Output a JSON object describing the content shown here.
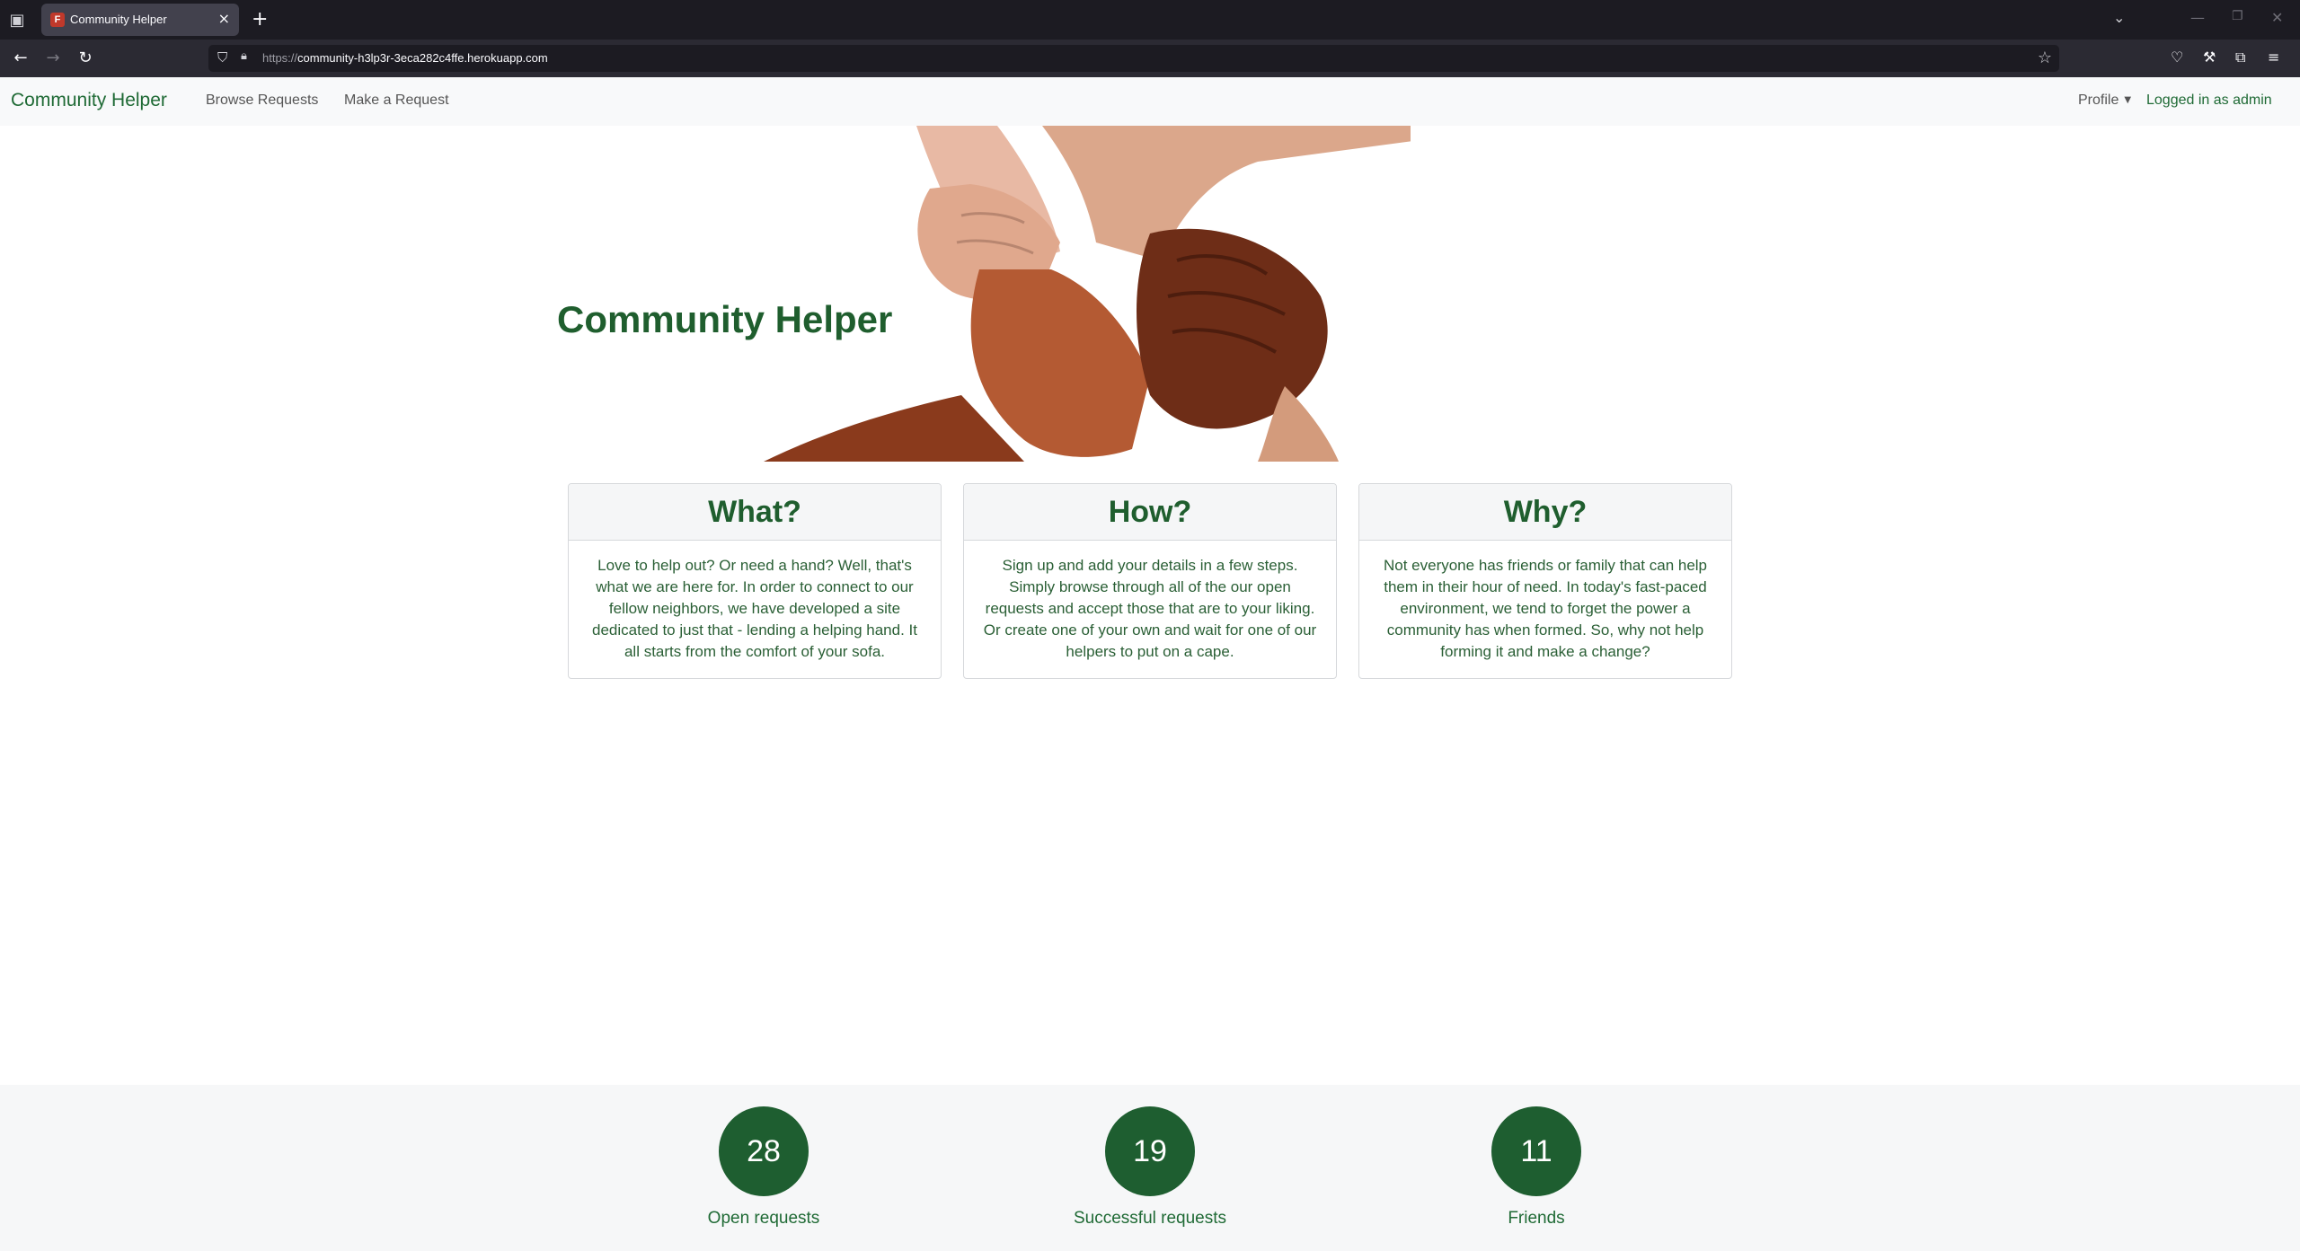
{
  "browser": {
    "tab_title": "Community Helper",
    "favicon_letter": "F",
    "url_protocol": "https://",
    "url_host": "community-h3lp3r-3eca282c4ffe.herokuapp.com"
  },
  "nav": {
    "brand": "Community Helper",
    "browse": "Browse Requests",
    "make": "Make a Request",
    "profile": "Profile",
    "logged_in": "Logged in as admin"
  },
  "hero": {
    "title": "Community Helper"
  },
  "cards": [
    {
      "title": "What?",
      "body": "Love to help out? Or need a hand? Well, that's what we are here for. In order to connect to our fellow neighbors, we have developed a site dedicated to just that - lending a helping hand. It all starts from the comfort of your sofa."
    },
    {
      "title": "How?",
      "body": "Sign up and add your details in a few steps. Simply browse through all of the our open requests and accept those that are to your liking. Or create one of your own and wait for one of our helpers to put on a cape."
    },
    {
      "title": "Why?",
      "body": "Not everyone has friends or family that can help them in their hour of need. In today's fast-paced environment, we tend to forget the power a community has when formed. So, why not help forming it and make a change?"
    }
  ],
  "stats": [
    {
      "value": "28",
      "label": "Open requests"
    },
    {
      "value": "19",
      "label": "Successful requests"
    },
    {
      "value": "11",
      "label": "Friends"
    }
  ],
  "colors": {
    "brand_green": "#1f6a35",
    "circle_green": "#1e5e30"
  }
}
